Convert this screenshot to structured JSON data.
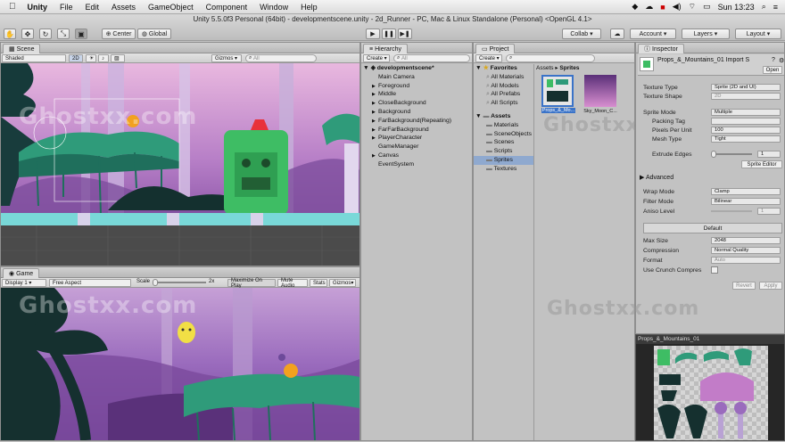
{
  "menubar": {
    "app": "Unity",
    "items": [
      "File",
      "Edit",
      "Assets",
      "GameObject",
      "Component",
      "Window",
      "Help"
    ],
    "clock": "Sun 13:23"
  },
  "window": {
    "title": "Unity 5.5.0f3 Personal (64bit) - developmentscene.unity - 2d_Runner - PC, Mac & Linux Standalone (Personal) <OpenGL 4.1>",
    "center_label": "Center",
    "global_label": "Global",
    "collab_label": "Collab",
    "account_label": "Account",
    "layers_label": "Layers",
    "layout_label": "Layout"
  },
  "scene": {
    "tab": "Scene",
    "shading": "Shaded",
    "mode_2d": "2D",
    "gizmos": "Gizmos",
    "search_placeholder": "All"
  },
  "game": {
    "tab": "Game",
    "display": "Display 1",
    "aspect": "Free Aspect",
    "scale_label": "Scale",
    "scale_value": "2x",
    "maximize": "Maximize On Play",
    "mute": "Mute Audio",
    "stats": "Stats",
    "gizmos": "Gizmos"
  },
  "hierarchy": {
    "tab": "Hierarchy",
    "create": "Create",
    "search_placeholder": "All",
    "scene_name": "developmentscene*",
    "items": [
      {
        "label": "Main Camera",
        "arrow": ""
      },
      {
        "label": "Foreground",
        "arrow": "▶"
      },
      {
        "label": "Middle",
        "arrow": "▶"
      },
      {
        "label": "CloseBackground",
        "arrow": "▶"
      },
      {
        "label": "Background",
        "arrow": "▶"
      },
      {
        "label": "FarBackground(Repeating)",
        "arrow": "▶"
      },
      {
        "label": "FarFarBackground",
        "arrow": "▶"
      },
      {
        "label": "PlayerCharacter",
        "arrow": "▶"
      },
      {
        "label": "GameManager",
        "arrow": ""
      },
      {
        "label": "Canvas",
        "arrow": "▶"
      },
      {
        "label": "EventSystem",
        "arrow": ""
      }
    ]
  },
  "project": {
    "tab": "Project",
    "create": "Create",
    "favorites_label": "Favorites",
    "favorites": [
      "All Materials",
      "All Models",
      "All Prefabs",
      "All Scripts"
    ],
    "assets_label": "Assets",
    "folders": [
      "Materials",
      "SceneObjects",
      "Scenes",
      "Scripts",
      "Sprites",
      "Textures"
    ],
    "selected_folder": "Sprites",
    "breadcrumb_root": "Assets",
    "breadcrumb_sep": "▸",
    "breadcrumb_current": "Sprites",
    "thumbs": [
      "Props_&_Mo...",
      "Sky_Moon_C..."
    ]
  },
  "inspector": {
    "tab": "Inspector",
    "title": "Props_&_Mountains_01 Import S",
    "open_label": "Open",
    "fields": [
      {
        "label": "Texture Type",
        "value": "Sprite (2D and UI)",
        "dim": false
      },
      {
        "label": "Texture Shape",
        "value": "2D",
        "dim": true
      },
      {
        "label": "Sprite Mode",
        "value": "Multiple",
        "dim": false
      },
      {
        "label": "Packing Tag",
        "value": "",
        "dim": false
      },
      {
        "label": "Pixels Per Unit",
        "value": "100",
        "dim": false
      },
      {
        "label": "Mesh Type",
        "value": "Tight",
        "dim": false
      }
    ],
    "extrude_label": "Extrude Edges",
    "extrude_value": "1",
    "sprite_editor": "Sprite Editor",
    "advanced_label": "Advanced",
    "wrap_label": "Wrap Mode",
    "wrap_value": "Clamp",
    "filter_label": "Filter Mode",
    "filter_value": "Bilinear",
    "aniso_label": "Aniso Level",
    "aniso_value": "1",
    "platform_default": "Default",
    "max_size_label": "Max Size",
    "max_size_value": "2048",
    "compression_label": "Compression",
    "compression_value": "Normal Quality",
    "format_label": "Format",
    "format_value": "Auto",
    "crunch_label": "Use Crunch Compres",
    "revert_label": "Revert",
    "apply_label": "Apply",
    "preview_title": "Props_&_Mountains_01",
    "colors": {
      "accent": "#3a73c8",
      "selection": "#3e7bd8"
    }
  },
  "watermark": "Ghostxx.com"
}
